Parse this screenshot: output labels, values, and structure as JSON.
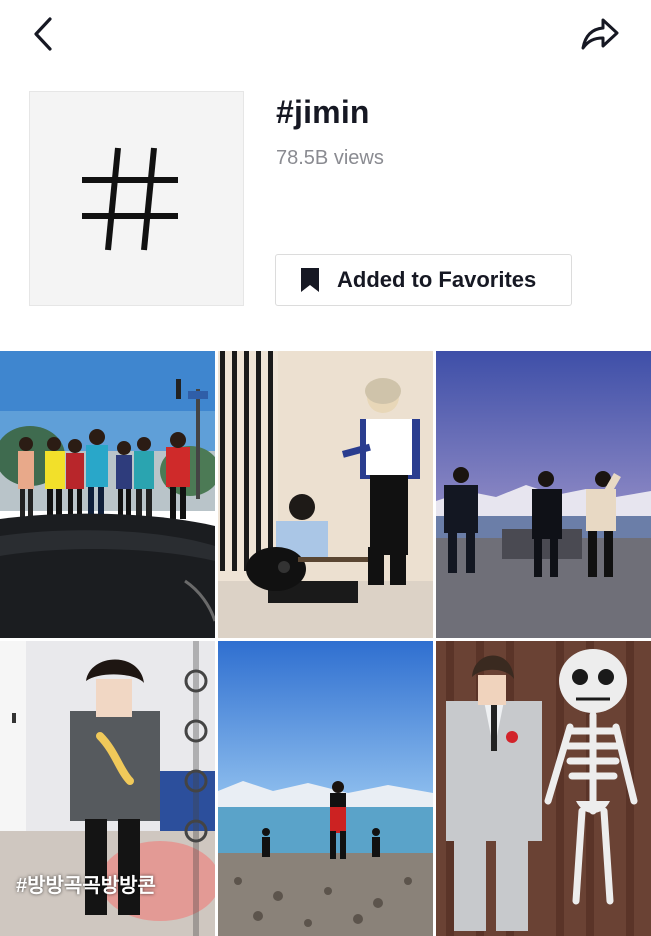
{
  "header": {
    "back_icon": "chevron-left-icon",
    "share_icon": "share-arrow-icon"
  },
  "hashtag": {
    "icon": "hashtag-icon",
    "title": "#jimin",
    "views": "78.5B views",
    "favorite_label": "Added to Favorites",
    "favorite_icon": "bookmark-icon"
  },
  "videos": [
    {
      "scene": "group-dance-street-car"
    },
    {
      "scene": "guitar-and-singer-studio"
    },
    {
      "scene": "three-dancers-lake-dusk"
    },
    {
      "scene": "selfie-with-watch-overlay",
      "caption": "#방방곡곡방방콘"
    },
    {
      "scene": "beach-lake-mountains"
    },
    {
      "scene": "grey-suit-with-skeleton"
    }
  ],
  "colors": {
    "text": "#161823",
    "muted": "#8a8b91",
    "border": "#dcdcdc",
    "thumb_bg": "#f4f4f4"
  }
}
